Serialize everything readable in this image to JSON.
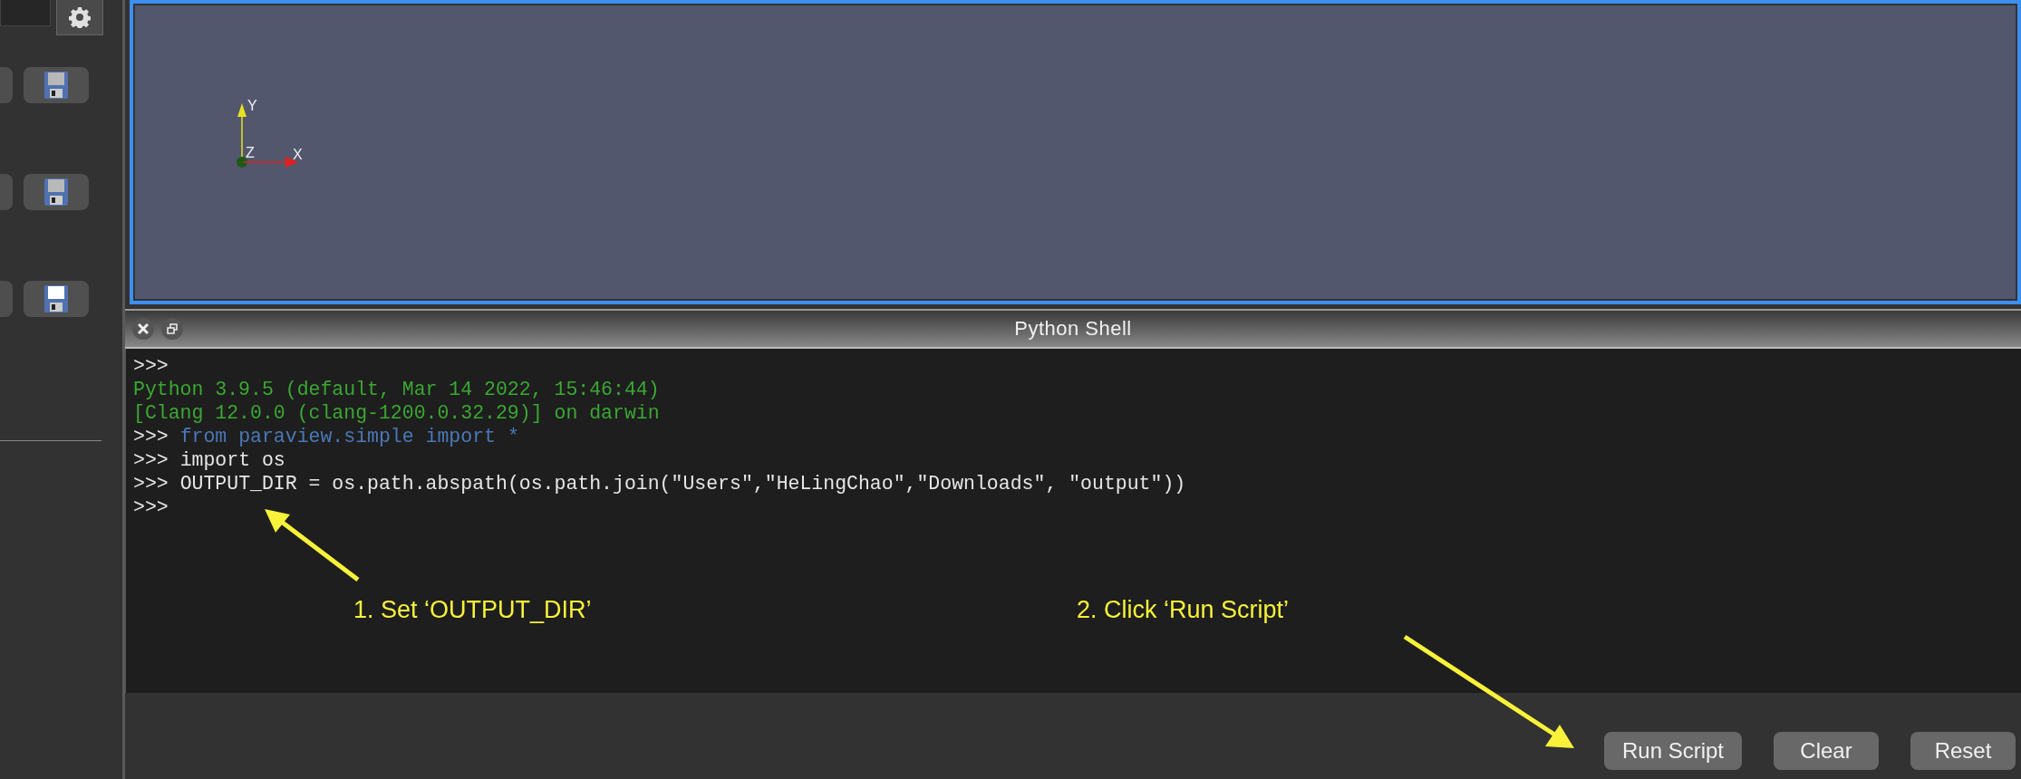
{
  "viewport": {
    "axes": [
      {
        "label": "Y",
        "kind": "y",
        "color": "#e8e020"
      },
      {
        "label": "Z",
        "kind": "z",
        "color": "#1e5a14"
      },
      {
        "label": "X",
        "kind": "x",
        "color": "#e02020"
      }
    ]
  },
  "sidebar": {
    "save_buttons": [
      {
        "disabled": true
      },
      {
        "disabled": true
      },
      {
        "disabled": false
      }
    ]
  },
  "shell": {
    "title": "Python Shell",
    "lines": [
      {
        "kind": "prompt",
        "prompt": ">>>"
      },
      {
        "kind": "output",
        "text": "Python 3.9.5 (default, Mar 14 2022, 15:46:44)"
      },
      {
        "kind": "output",
        "text": "[Clang 12.0.0 (clang-1200.0.32.29)] on darwin"
      },
      {
        "kind": "auto",
        "prompt": ">>>",
        "text": "from paraview.simple import *"
      },
      {
        "kind": "prompt",
        "prompt": ">>>",
        "text": "import os"
      },
      {
        "kind": "prompt",
        "prompt": ">>>",
        "text": "OUTPUT_DIR = os.path.abspath(os.path.join(\"Users\",\"HeLingChao\",\"Downloads\", \"output\"))"
      },
      {
        "kind": "prompt",
        "prompt": ">>>"
      }
    ],
    "buttons": [
      "Run Script",
      "Clear",
      "Reset"
    ]
  },
  "annotations": [
    {
      "text": "1. Set ‘OUTPUT_DIR’"
    },
    {
      "text": "2. Click ‘Run Script’"
    }
  ]
}
